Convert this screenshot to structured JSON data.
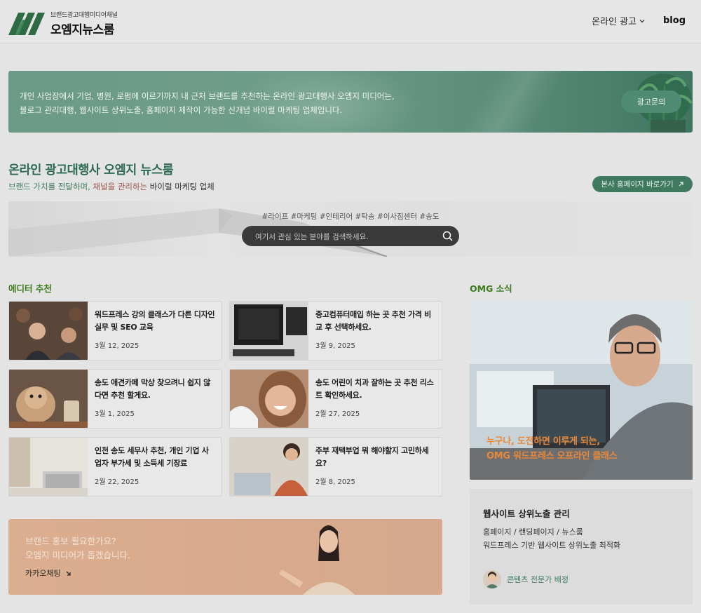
{
  "header": {
    "logo_sub": "브랜드광고대행미디어채널",
    "logo_main": "오엠지뉴스룸",
    "nav_ad": "온라인 광고",
    "nav_blog": "blog"
  },
  "banner": {
    "line1": "개인 사업장에서 기업, 병원, 로펌에 이르기까지 내 근처 브랜드를 추천하는 온라인 광고대행사 오엠지 미디어는,",
    "line2": "블로그 관리대행, 웹사이트 상위노출, 홈페이지 제작이 가능한 신개념 바이럴 마케팅 업체입니다.",
    "button": "광고문의"
  },
  "intro": {
    "title": "온라인 광고대행사 오엠지 뉴스룸",
    "sub_a": "브랜드 가치를 전달하며, ",
    "sub_b": "채널을 관리하는",
    "sub_c": " 바이럴 마케팅 업체",
    "home_button": "본사 홈페이지 바로가기"
  },
  "search": {
    "tags": "#라이프 #마케팅 #인테리어 #탁송 #이사짐센터 #송도",
    "placeholder": "여기서 관심 있는 분야를 검색하세요."
  },
  "editor": {
    "heading": "에디터 추천",
    "cards": [
      {
        "title": "워드프레스 강의 클래스가 다른 디자인 실무 및 SEO 교육",
        "date": "3월 12, 2025"
      },
      {
        "title": "중고컴퓨터매입 하는 곳 추천 가격 비교 후 선택하세요.",
        "date": "3월 9, 2025"
      },
      {
        "title": "송도 애견카페 막상 찾으려니 쉽지 않다면 추천 할게요.",
        "date": "3월 1, 2025"
      },
      {
        "title": "송도 어린이 치과 잘하는 곳 추천 리스트 확인하세요.",
        "date": "2월 27, 2025"
      },
      {
        "title": "인천 송도 세무사 추천, 개인 기업 사업자 부가세 및 소득세 기장료",
        "date": "2월 22, 2025"
      },
      {
        "title": "주부 재택부업 뭐 해야할지 고민하세요?",
        "date": "2월 8, 2025"
      }
    ]
  },
  "promo": {
    "line1": "브랜드 홍보 필요한가요?",
    "line2": "오엠지 미디어가 돕겠습니다.",
    "link": "카카오채팅"
  },
  "omg": {
    "heading": "OMG 소식",
    "caption1": "누구나, 도전하면 이루게 되는,",
    "caption2": "OMG 워드프레스 오프라인 클래스"
  },
  "side": {
    "heading": "웹사이트 상위노출 관리",
    "line1": "홈페이지 / 랜딩페이지 / 뉴스룸",
    "line2": "워드프레스 기반 웹사이트 상위노출 최적화",
    "expert": "콘텐츠 전문가 배정"
  },
  "colors": {
    "brand_green": "#2f6b52",
    "heading_green": "#3c7a1e",
    "caption_orange": "#e8893a"
  }
}
